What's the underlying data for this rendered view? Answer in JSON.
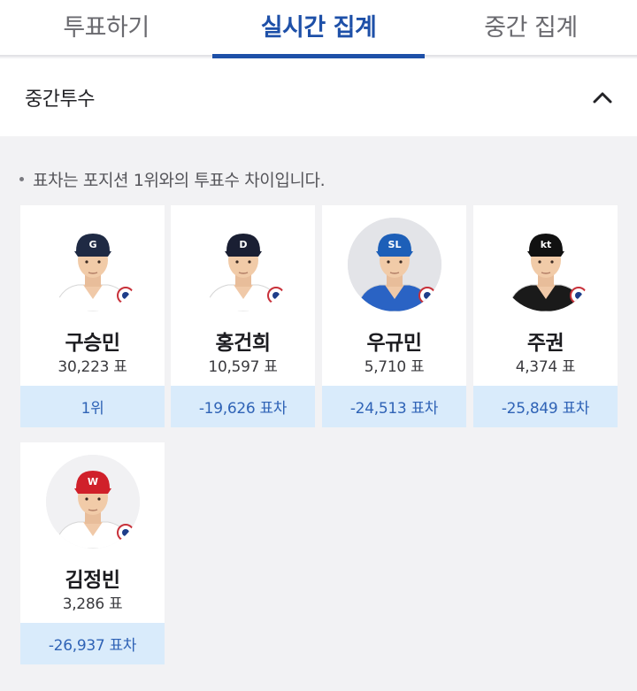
{
  "tabs": [
    {
      "label": "투표하기",
      "active": false
    },
    {
      "label": "실시간 집계",
      "active": true
    },
    {
      "label": "중간 집계",
      "active": false
    }
  ],
  "section": {
    "title": "중간투수",
    "expanded": true,
    "toggle_icon": "chevron-up-icon"
  },
  "notice": "표차는 포지션 1위와의 투표수 차이입니다.",
  "players": [
    {
      "name": "구승민",
      "votes": "30,223 표",
      "gap": "1위",
      "team_icon": "giants-logo",
      "cap_color": "#1f2a44",
      "cap_letter": "G",
      "uniform_color": "#ffffff",
      "bg_color": "#ffffff"
    },
    {
      "name": "홍건희",
      "votes": "10,597 표",
      "gap": "-19,626 표차",
      "team_icon": "bears-logo",
      "cap_color": "#1a1f33",
      "cap_letter": "D",
      "uniform_color": "#ffffff",
      "bg_color": "#ffffff"
    },
    {
      "name": "우규민",
      "votes": "5,710 표",
      "gap": "-24,513 표차",
      "team_icon": "lions-logo",
      "cap_color": "#1d5fb8",
      "cap_letter": "SL",
      "uniform_color": "#2a63c4",
      "bg_color": "#e3e4e8"
    },
    {
      "name": "주권",
      "votes": "4,374 표",
      "gap": "-25,849 표차",
      "team_icon": "wiz-logo",
      "cap_color": "#111111",
      "cap_letter": "kt",
      "uniform_color": "#1a1a1a",
      "bg_color": "#ffffff"
    },
    {
      "name": "김정빈",
      "votes": "3,286 표",
      "gap": "-26,937 표차",
      "team_icon": "landers-logo",
      "cap_color": "#d0202a",
      "cap_letter": "W",
      "uniform_color": "#ffffff",
      "bg_color": "#f1f1f3"
    }
  ]
}
